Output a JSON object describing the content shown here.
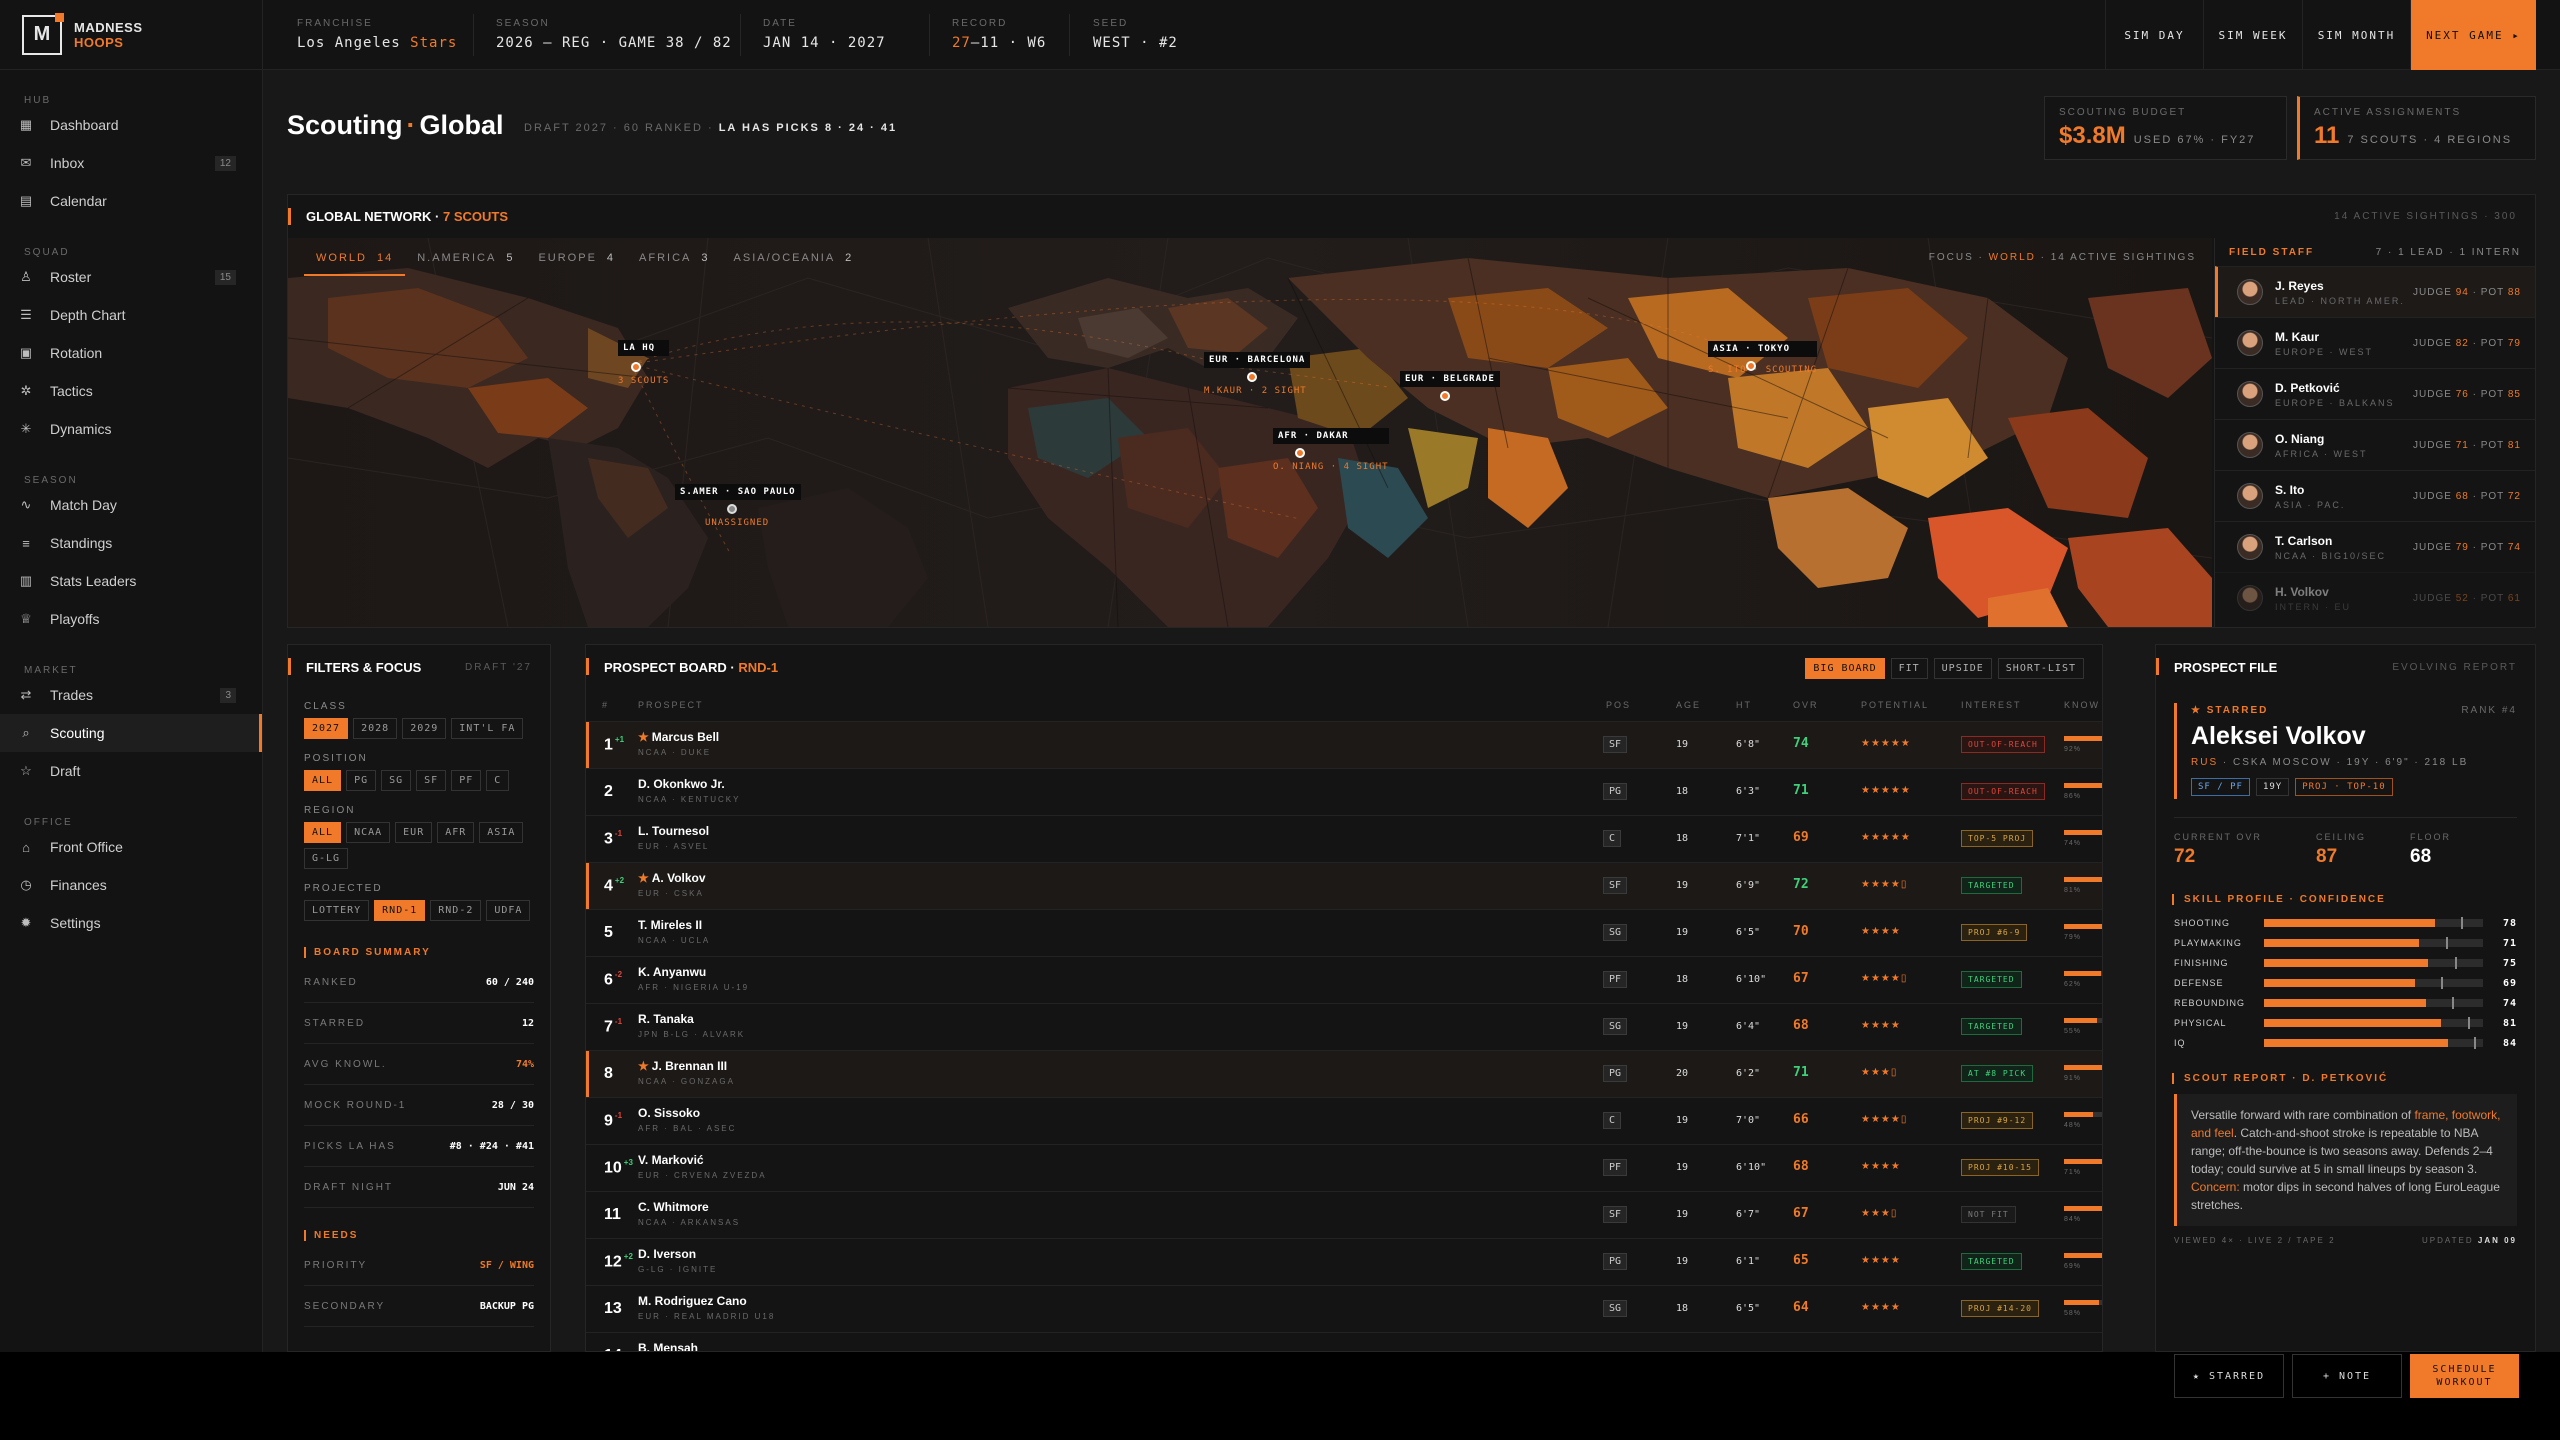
{
  "brand": {
    "line1": "MADNESS",
    "line2": "HOOPS",
    "mark": "M"
  },
  "topbar": {
    "stats": [
      {
        "label": "FRANCHISE",
        "value_a": "Los Angeles ",
        "value_b": "Stars"
      },
      {
        "label": "SEASON",
        "value_a": "2026 — REG · GAME 38 / 82",
        "value_b": ""
      },
      {
        "label": "DATE",
        "value_a": "JAN 14 · 2027",
        "value_b": ""
      },
      {
        "label": "RECORD",
        "value_a": "27",
        "value_b": "–11 · W6"
      },
      {
        "label": "SEED",
        "value_a": "WEST · #2",
        "value_b": ""
      }
    ],
    "buttons": [
      "SIM DAY",
      "SIM WEEK",
      "SIM MONTH",
      "NEXT GAME ▸"
    ]
  },
  "sidebar": {
    "sections": [
      {
        "title": "HUB",
        "items": [
          {
            "label": "Dashboard",
            "icon": "grid-icon",
            "glyph": "▦",
            "count": ""
          },
          {
            "label": "Inbox",
            "icon": "mail-icon",
            "glyph": "✉",
            "count": "12"
          },
          {
            "label": "Calendar",
            "icon": "calendar-icon",
            "glyph": "▤",
            "count": ""
          }
        ]
      },
      {
        "title": "SQUAD",
        "items": [
          {
            "label": "Roster",
            "icon": "user-icon",
            "glyph": "♙",
            "count": "15"
          },
          {
            "label": "Depth Chart",
            "icon": "layers-icon",
            "glyph": "☰",
            "count": ""
          },
          {
            "label": "Rotation",
            "icon": "rotation-icon",
            "glyph": "▣",
            "count": ""
          },
          {
            "label": "Tactics",
            "icon": "tactics-icon",
            "glyph": "✲",
            "count": ""
          },
          {
            "label": "Dynamics",
            "icon": "dynamics-icon",
            "glyph": "✳",
            "count": ""
          }
        ]
      },
      {
        "title": "SEASON",
        "items": [
          {
            "label": "Match Day",
            "icon": "pulse-icon",
            "glyph": "∿",
            "count": ""
          },
          {
            "label": "Standings",
            "icon": "list-icon",
            "glyph": "≡",
            "count": ""
          },
          {
            "label": "Stats Leaders",
            "icon": "bar-chart-icon",
            "glyph": "▥",
            "count": ""
          },
          {
            "label": "Playoffs",
            "icon": "trophy-icon",
            "glyph": "♕",
            "count": ""
          }
        ]
      },
      {
        "title": "MARKET",
        "items": [
          {
            "label": "Trades",
            "icon": "swap-icon",
            "glyph": "⇄",
            "count": "3"
          },
          {
            "label": "Scouting",
            "icon": "search-icon",
            "glyph": "⌕",
            "count": "",
            "active": true
          },
          {
            "label": "Draft",
            "icon": "star-icon",
            "glyph": "☆",
            "count": ""
          }
        ]
      },
      {
        "title": "OFFICE",
        "items": [
          {
            "label": "Front Office",
            "icon": "building-icon",
            "glyph": "⌂",
            "count": ""
          },
          {
            "label": "Finances",
            "icon": "finance-icon",
            "glyph": "◷",
            "count": ""
          },
          {
            "label": "Settings",
            "icon": "gear-icon",
            "glyph": "✹",
            "count": ""
          }
        ]
      }
    ]
  },
  "header": {
    "title_a": "Scouting",
    "title_sep": "·",
    "title_b": "Global",
    "meta_a": "DRAFT 2027 · 60 RANKED ·",
    "meta_b": "LA HAS PICKS 8 · 24 · 41",
    "budget": {
      "label": "SCOUTING BUDGET",
      "value": "$3.8M",
      "sub": "USED 67% · FY27"
    },
    "assign": {
      "label": "ACTIVE ASSIGNMENTS",
      "value": "11",
      "sub": "7 SCOUTS · 4 REGIONS"
    }
  },
  "network": {
    "title": "GLOBAL NETWORK ·",
    "count": "7 SCOUTS",
    "right": "14 ACTIVE SIGHTINGS · 300",
    "tabs": [
      {
        "label": "WORLD",
        "num": "14",
        "active": true
      },
      {
        "label": "N.AMERICA",
        "num": "5"
      },
      {
        "label": "EUROPE",
        "num": "4"
      },
      {
        "label": "AFRICA",
        "num": "3"
      },
      {
        "label": "ASIA/OCEANIA",
        "num": "2"
      }
    ],
    "focus_a": "FOCUS ·",
    "focus_b": "WORLD",
    "focus_c": "· 14 ACTIVE SIGHTINGS",
    "pins": [
      {
        "label": "LA HQ",
        "sub": "3 SCOUTS",
        "dot": "orange"
      },
      {
        "label": "EUR · BARCELONA",
        "sub": "M.KAUR · 2 SIGHT",
        "dot": "orange"
      },
      {
        "label": "EUR · BELGRADE",
        "sub": "",
        "dot": "orange"
      },
      {
        "label": "ASIA · TOKYO",
        "sub": "S. ITO · SCOUTING",
        "dot": "orange"
      },
      {
        "label": "AFR · DAKAR",
        "sub": "O. NIANG · 4 SIGHT",
        "dot": "orange"
      },
      {
        "label": "S.AMER · SAO PAULO",
        "sub": "UNASSIGNED",
        "dot": "gray"
      }
    ]
  },
  "staff": {
    "title": "FIELD STAFF",
    "summary": "7 · 1 LEAD · 1 INTERN",
    "rows": [
      {
        "name": "J. Reyes",
        "sub": "LEAD · NORTH AMER.",
        "judge": "94",
        "pot": "88"
      },
      {
        "name": "M. Kaur",
        "sub": "EUROPE · WEST",
        "judge": "82",
        "pot": "79"
      },
      {
        "name": "D. Petković",
        "sub": "EUROPE · BALKANS",
        "judge": "76",
        "pot": "85"
      },
      {
        "name": "O. Niang",
        "sub": "AFRICA · WEST",
        "judge": "71",
        "pot": "81"
      },
      {
        "name": "S. Ito",
        "sub": "ASIA · PAC.",
        "judge": "68",
        "pot": "72"
      },
      {
        "name": "T. Carlson",
        "sub": "NCAA · BIG10/SEC",
        "judge": "79",
        "pot": "74"
      },
      {
        "name": "H. Volkov",
        "sub": "INTERN · EU",
        "judge": "52",
        "pot": "61"
      }
    ]
  },
  "filters": {
    "title": "FILTERS & FOCUS",
    "tag": "DRAFT '27",
    "groups": [
      {
        "label": "CLASS",
        "chips": [
          "2027",
          "2028",
          "2029",
          "INT'L FA"
        ],
        "on": 0
      },
      {
        "label": "POSITION",
        "chips": [
          "ALL",
          "PG",
          "SG",
          "SF",
          "PF",
          "C"
        ],
        "on": 0
      },
      {
        "label": "REGION",
        "chips": [
          "ALL",
          "NCAA",
          "EUR",
          "AFR",
          "ASIA",
          "G-LG"
        ],
        "on": 0
      },
      {
        "label": "PROJECTED",
        "chips": [
          "LOTTERY",
          "RND-1",
          "RND-2",
          "UDFA"
        ],
        "on": 1
      }
    ],
    "summary_title": "BOARD SUMMARY",
    "summary": [
      {
        "k": "RANKED",
        "v": "60 / 240"
      },
      {
        "k": "STARRED",
        "v": "12"
      },
      {
        "k": "AVG KNOWL.",
        "v": "74%"
      },
      {
        "k": "MOCK ROUND-1",
        "v": "28 / 30"
      },
      {
        "k": "PICKS LA HAS",
        "v": "#8 · #24 · #41"
      },
      {
        "k": "DRAFT NIGHT",
        "v": "JUN 24"
      }
    ],
    "needs_title": "NEEDS",
    "needs": [
      {
        "k": "PRIORITY",
        "v": "SF / WING"
      },
      {
        "k": "SECONDARY",
        "v": "BACKUP PG"
      }
    ]
  },
  "board": {
    "title": "PROSPECT BOARD ·",
    "filter": "RND-1",
    "tabs": [
      "BIG BOARD",
      "FIT",
      "UPSIDE",
      "SHORT-LIST"
    ],
    "columns": [
      "#",
      "PROSPECT",
      "POS",
      "AGE",
      "HT",
      "OVR",
      "POTENTIAL",
      "INTEREST",
      "KNOW"
    ],
    "rows": [
      {
        "rank": "1",
        "move": "+1",
        "dir": "up",
        "star": true,
        "name": "Marcus Bell",
        "sub": "NCAA · DUKE",
        "pos": "SF",
        "age": "19",
        "ht": "6'8\"",
        "ovr": "74",
        "ovr_c": "green",
        "pot": "★★★★★",
        "tag": "OUT-OF-REACH",
        "tag_c": "red",
        "know": 0.92,
        "know_t": "92%"
      },
      {
        "rank": "2",
        "move": "",
        "dir": "",
        "star": false,
        "name": "D. Okonkwo Jr.",
        "sub": "NCAA · KENTUCKY",
        "pos": "PG",
        "age": "18",
        "ht": "6'3\"",
        "ovr": "71",
        "ovr_c": "green",
        "pot": "★★★★★",
        "tag": "OUT-OF-REACH",
        "tag_c": "red",
        "know": 0.86,
        "know_t": "86%"
      },
      {
        "rank": "3",
        "move": "-1",
        "dir": "down",
        "star": false,
        "name": "L. Tournesol",
        "sub": "EUR · ASVEL",
        "pos": "C",
        "age": "18",
        "ht": "7'1\"",
        "ovr": "69",
        "ovr_c": "orange",
        "pot": "★★★★★",
        "tag": "TOP-5 PROJ",
        "tag_c": "gold",
        "know": 0.74,
        "know_t": "74%"
      },
      {
        "rank": "4",
        "move": "+2",
        "dir": "up",
        "star": true,
        "name": "A. Volkov",
        "sub": "EUR · CSKA",
        "pos": "SF",
        "age": "19",
        "ht": "6'9\"",
        "ovr": "72",
        "ovr_c": "green",
        "pot": "★★★★▯",
        "tag": "TARGETED",
        "tag_c": "green",
        "know": 0.81,
        "know_t": "81%"
      },
      {
        "rank": "5",
        "move": "",
        "dir": "",
        "star": false,
        "name": "T. Mireles II",
        "sub": "NCAA · UCLA",
        "pos": "SG",
        "age": "19",
        "ht": "6'5\"",
        "ovr": "70",
        "ovr_c": "orange",
        "pot": "★★★★",
        "tag": "PROJ #6-9",
        "tag_c": "gold",
        "know": 0.79,
        "know_t": "79%"
      },
      {
        "rank": "6",
        "move": "-2",
        "dir": "down",
        "star": false,
        "name": "K. Anyanwu",
        "sub": "AFR · NIGERIA U-19",
        "pos": "PF",
        "age": "18",
        "ht": "6'10\"",
        "ovr": "67",
        "ovr_c": "orange",
        "pot": "★★★★▯",
        "tag": "TARGETED",
        "tag_c": "green",
        "know": 0.62,
        "know_t": "62%"
      },
      {
        "rank": "7",
        "move": "-1",
        "dir": "down",
        "star": false,
        "name": "R. Tanaka",
        "sub": "JPN B-LG · ALVARK",
        "pos": "SG",
        "age": "19",
        "ht": "6'4\"",
        "ovr": "68",
        "ovr_c": "orange",
        "pot": "★★★★",
        "tag": "TARGETED",
        "tag_c": "green",
        "know": 0.55,
        "know_t": "55%"
      },
      {
        "rank": "8",
        "move": "",
        "dir": "",
        "star": true,
        "name": "J. Brennan III",
        "sub": "NCAA · GONZAGA",
        "pos": "PG",
        "age": "20",
        "ht": "6'2\"",
        "ovr": "71",
        "ovr_c": "green",
        "pot": "★★★▯",
        "tag": "AT #8 PICK",
        "tag_c": "green",
        "know": 0.91,
        "know_t": "91%"
      },
      {
        "rank": "9",
        "move": "-1",
        "dir": "down",
        "star": false,
        "name": "O. Sissoko",
        "sub": "AFR · BAL · ASEC",
        "pos": "C",
        "age": "19",
        "ht": "7'0\"",
        "ovr": "66",
        "ovr_c": "orange",
        "pot": "★★★★▯",
        "tag": "PROJ #9-12",
        "tag_c": "gold",
        "know": 0.48,
        "know_t": "48%"
      },
      {
        "rank": "10",
        "move": "+3",
        "dir": "up",
        "star": false,
        "name": "V. Marković",
        "sub": "EUR · CRVENA ZVEZDA",
        "pos": "PF",
        "age": "19",
        "ht": "6'10\"",
        "ovr": "68",
        "ovr_c": "orange",
        "pot": "★★★★",
        "tag": "PROJ #10-15",
        "tag_c": "gold",
        "know": 0.71,
        "know_t": "71%"
      },
      {
        "rank": "11",
        "move": "",
        "dir": "",
        "star": false,
        "name": "C. Whitmore",
        "sub": "NCAA · ARKANSAS",
        "pos": "SF",
        "age": "19",
        "ht": "6'7\"",
        "ovr": "67",
        "ovr_c": "orange",
        "pot": "★★★▯",
        "tag": "NOT FIT",
        "tag_c": "gray",
        "know": 0.84,
        "know_t": "84%"
      },
      {
        "rank": "12",
        "move": "+2",
        "dir": "up",
        "star": false,
        "name": "D. Iverson",
        "sub": "G-LG · IGNITE",
        "pos": "PG",
        "age": "19",
        "ht": "6'1\"",
        "ovr": "65",
        "ovr_c": "orange",
        "pot": "★★★★",
        "tag": "TARGETED",
        "tag_c": "green",
        "know": 0.69,
        "know_t": "69%"
      },
      {
        "rank": "13",
        "move": "",
        "dir": "",
        "star": false,
        "name": "M. Rodriguez Cano",
        "sub": "EUR · REAL MADRID U18",
        "pos": "SG",
        "age": "18",
        "ht": "6'5\"",
        "ovr": "64",
        "ovr_c": "orange",
        "pot": "★★★★",
        "tag": "PROJ #14-20",
        "tag_c": "gold",
        "know": 0.58,
        "know_t": "58%"
      },
      {
        "rank": "14",
        "move": "",
        "dir": "",
        "star": false,
        "name": "B. Mensah",
        "sub": "",
        "pos": "",
        "age": "",
        "ht": "",
        "ovr": "",
        "ovr_c": "orange",
        "pot": "",
        "tag": "",
        "tag_c": "gray",
        "know": 0,
        "know_t": ""
      }
    ]
  },
  "file": {
    "title": "PROSPECT FILE",
    "tag": "EVOLVING REPORT",
    "starred": "★ STARRED",
    "rank": "RANK #4",
    "name": "Aleksei Volkov",
    "bio_a": "RUS",
    "bio_b": "· CSKA MOSCOW · 19Y · 6'9\" · 218 LB",
    "pills": [
      "SF / PF",
      "19Y",
      "PROJ · TOP-10"
    ],
    "ratings": [
      {
        "k": "CURRENT OVR",
        "v": "72"
      },
      {
        "k": "CEILING",
        "v": "87"
      },
      {
        "k": "FLOOR",
        "v": "68"
      }
    ],
    "skills_title": "SKILL PROFILE · CONFIDENCE",
    "skills": [
      {
        "name": "SHOOTING",
        "value": 78
      },
      {
        "name": "PLAYMAKING",
        "value": 71
      },
      {
        "name": "FINISHING",
        "value": 75
      },
      {
        "name": "DEFENSE",
        "value": 69
      },
      {
        "name": "REBOUNDING",
        "value": 74
      },
      {
        "name": "PHYSICAL",
        "value": 81
      },
      {
        "name": "IQ",
        "value": 84
      }
    ],
    "report_title": "SCOUT REPORT · D. PETKOVIĆ",
    "report_1": "Versatile forward with rare combination of ",
    "report_hl1": "frame, footwork, and feel",
    "report_2": ". Catch-and-shoot stroke is repeatable to NBA range; off-the-bounce is two seasons away. Defends 2–4 today; could survive at 5 in small lineups by season 3. ",
    "report_hl2": "Concern:",
    "report_3": " motor dips in second halves of long EuroLeague stretches.",
    "viewed": "VIEWED 4× · LIVE 2 / TAPE 2",
    "updated_a": "UPDATED",
    "updated_b": "JAN 09",
    "buttons": [
      "★ STARRED",
      "+ NOTE",
      "SCHEDULE WORKOUT"
    ]
  },
  "colors": {
    "accent": "#f07a2a",
    "positive": "#3fd07a",
    "negative": "#e0463b",
    "gold": "#d9a441"
  }
}
